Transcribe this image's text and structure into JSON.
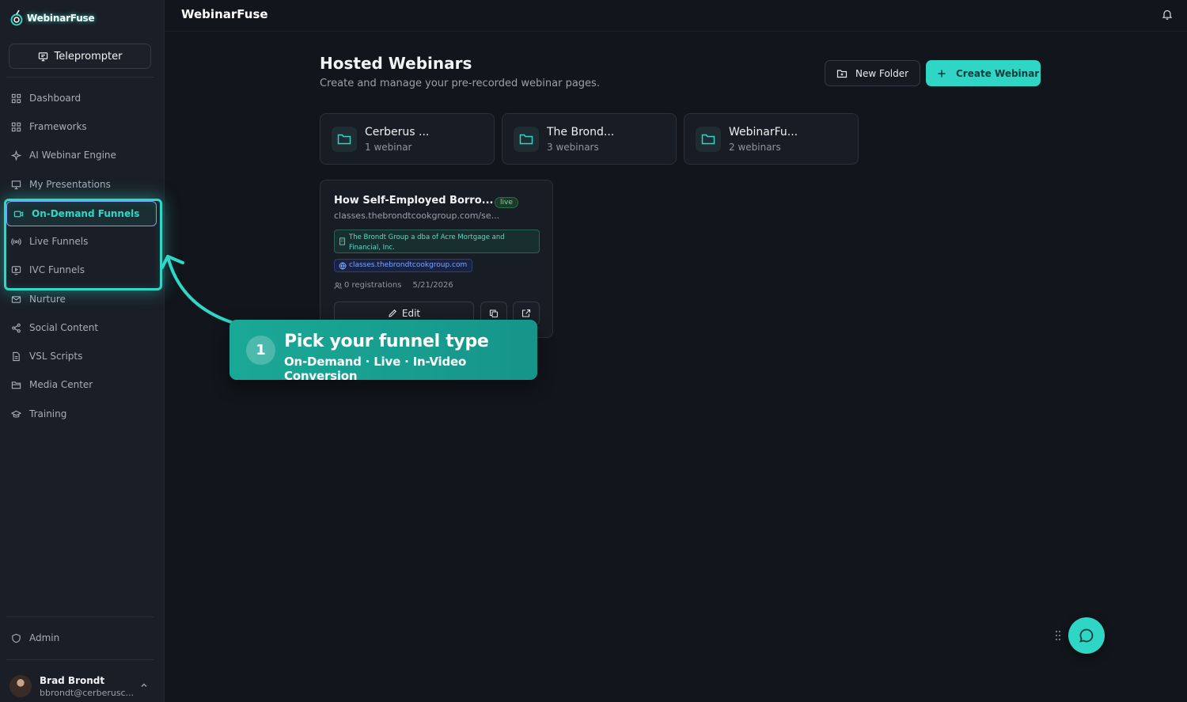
{
  "logo": {
    "text": "WebinarFuse"
  },
  "sidebar": {
    "teleprompter_label": "Teleprompter",
    "items": [
      {
        "label": "Dashboard",
        "icon": "grid-icon"
      },
      {
        "label": "Frameworks",
        "icon": "grid-icon"
      },
      {
        "label": "AI Webinar Engine",
        "icon": "sparkle-icon"
      },
      {
        "label": "My Presentations",
        "icon": "presentation-icon"
      },
      {
        "label": "On-Demand Funnels",
        "icon": "video-icon",
        "active": true
      },
      {
        "label": "Live Funnels",
        "icon": "broadcast-icon"
      },
      {
        "label": "IVC Funnels",
        "icon": "screen-play-icon"
      },
      {
        "label": "Nurture",
        "icon": "mail-icon"
      },
      {
        "label": "Social Content",
        "icon": "share-icon"
      },
      {
        "label": "VSL Scripts",
        "icon": "document-icon"
      },
      {
        "label": "Media Center",
        "icon": "folder-open-icon"
      },
      {
        "label": "Training",
        "icon": "graduation-cap-icon"
      }
    ],
    "admin_label": "Admin",
    "user": {
      "name": "Brad Brondt",
      "email": "bbrondt@cerberusc..."
    }
  },
  "topbar": {
    "title": "WebinarFuse"
  },
  "main": {
    "title": "Hosted Webinars",
    "subtitle": "Create and manage your pre-recorded webinar pages.",
    "new_folder_label": "New Folder",
    "create_label": "Create Webinar",
    "folders": [
      {
        "name": "Cerberus ...",
        "count": "1 webinar"
      },
      {
        "name": "The Brond...",
        "count": "3 webinars"
      },
      {
        "name": "WebinarFu...",
        "count": "2 webinars"
      }
    ],
    "webinar": {
      "title": "How Self-Employed Borro...",
      "status": "live",
      "url": "classes.thebrondtcookgroup.com/se...",
      "company": "The Brondt Group a dba of Acre Mortgage and Financial, Inc.",
      "domain": "classes.thebrondtcookgroup.com",
      "registrations": "0 registrations",
      "date": "5/21/2026",
      "edit_label": "Edit"
    }
  },
  "callout": {
    "number": "1",
    "title": "Pick your funnel type",
    "subtitle": "On-Demand · Live · In-Video Conversion"
  },
  "colors": {
    "accent": "#2fd6c5",
    "background": "#12151b",
    "sidebar": "#1a1e27"
  }
}
